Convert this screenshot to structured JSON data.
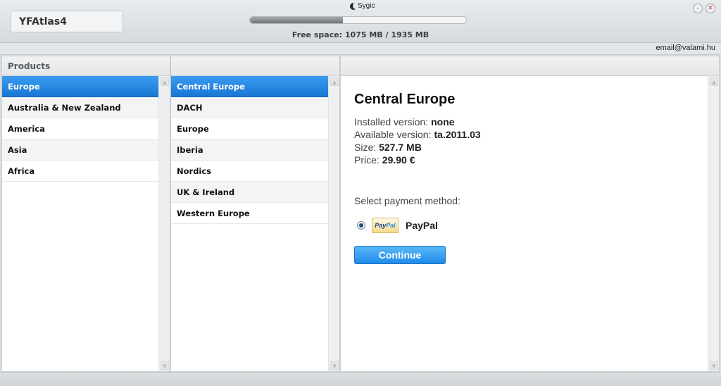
{
  "header": {
    "device_name": "YFAtlas4",
    "brand": "Sygic",
    "storage_used_fraction": 0.43,
    "free_space": "Free space: 1075 MB / 1935 MB"
  },
  "account": {
    "email": "email@valami.hu"
  },
  "products": {
    "title": "Products",
    "items": [
      {
        "label": "Europe",
        "selected": true
      },
      {
        "label": "Australia & New Zealand"
      },
      {
        "label": "America"
      },
      {
        "label": "Asia"
      },
      {
        "label": "Africa"
      }
    ]
  },
  "regions": {
    "items": [
      {
        "label": "Central Europe",
        "selected": true
      },
      {
        "label": "DACH"
      },
      {
        "label": "Europe"
      },
      {
        "label": "Iberia"
      },
      {
        "label": "Nordics"
      },
      {
        "label": "UK & Ireland"
      },
      {
        "label": "Western Europe"
      }
    ]
  },
  "details": {
    "title": "Central Europe",
    "installed_label": "Installed version:",
    "installed_value": "none",
    "available_label": "Available version:",
    "available_value": "ta.2011.03",
    "size_label": "Size:",
    "size_value": "527.7 MB",
    "price_label": "Price:",
    "price_value": "29.90 €",
    "payment_label": "Select payment method:",
    "payment_option": "PayPal",
    "continue_label": "Continue"
  },
  "colors": {
    "selected_bg": "#1f82e0",
    "button_bg": "#3aa2f0"
  }
}
